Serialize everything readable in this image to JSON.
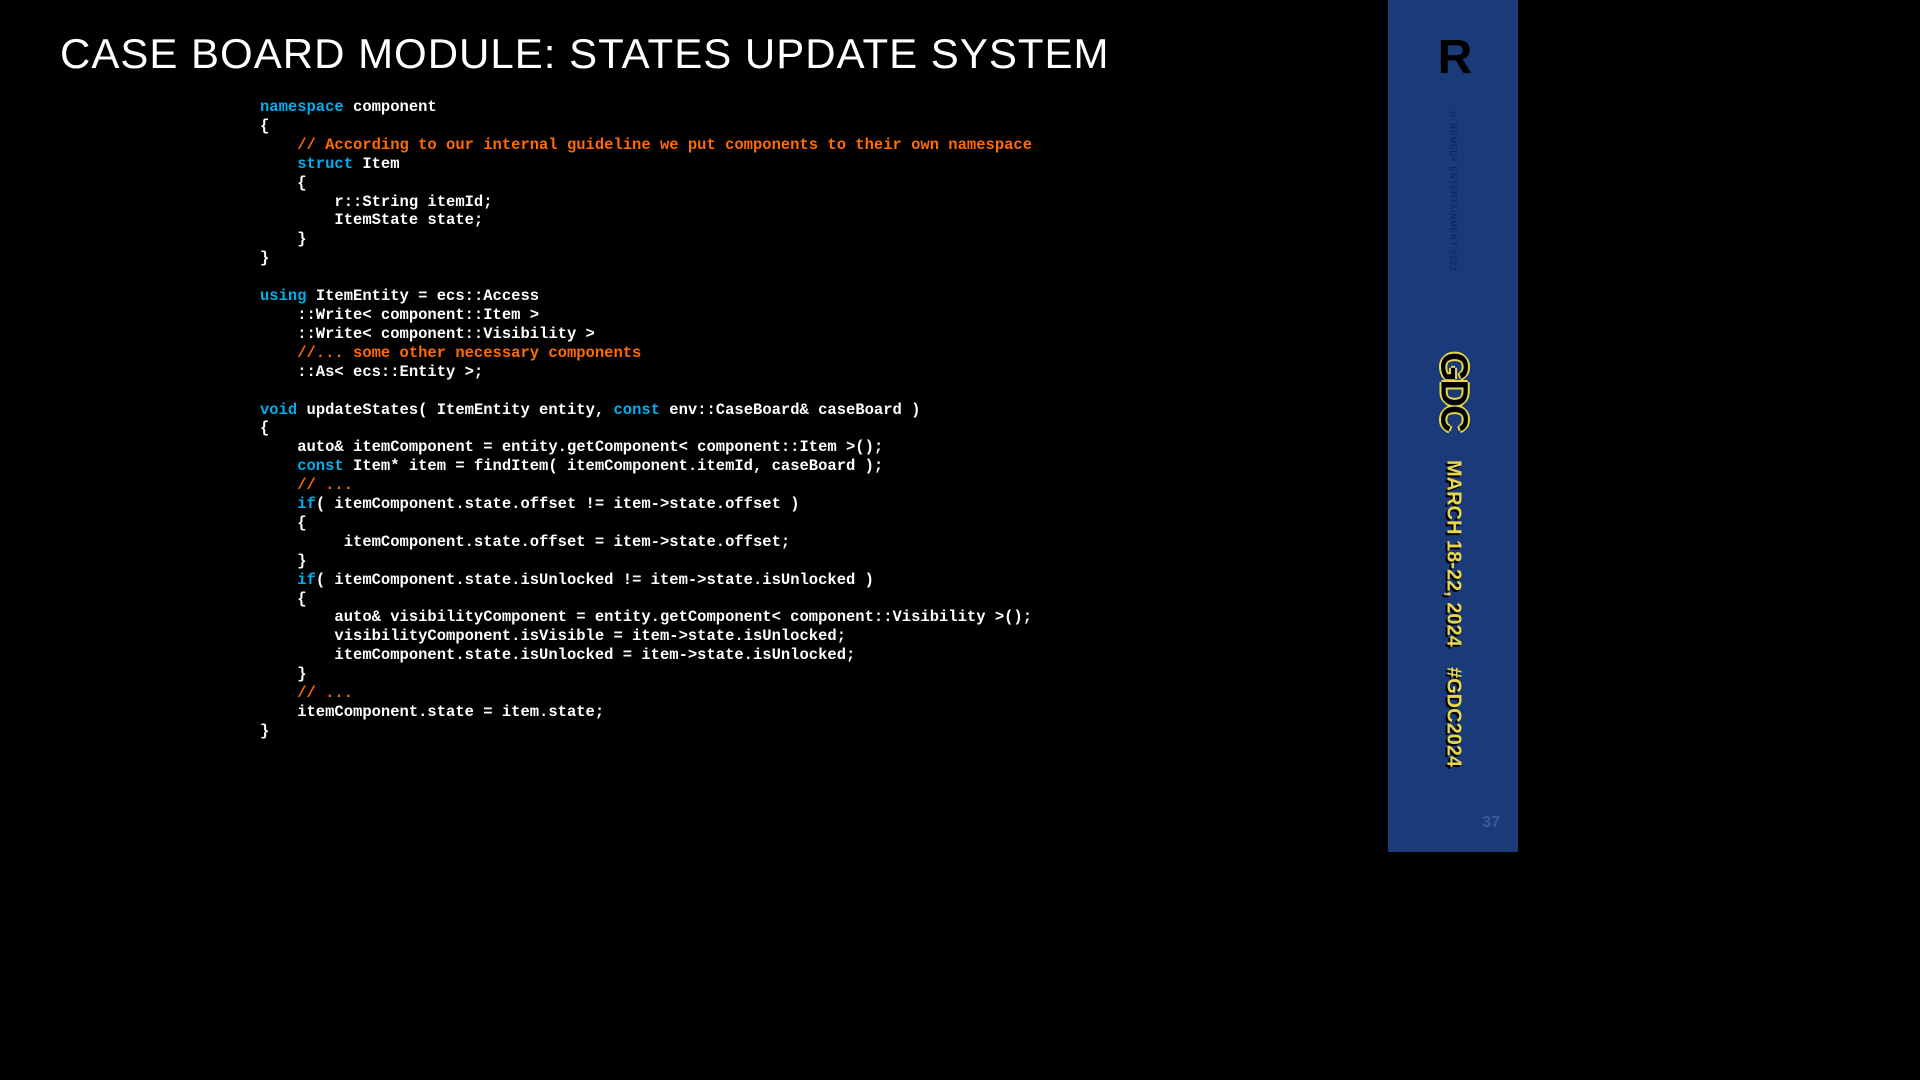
{
  "title": "CASE BOARD MODULE: STATES UPDATE SYSTEM",
  "code": {
    "l1a": "namespace",
    "l1b": " component",
    "l2": "{",
    "l3": "    // According to our internal guideline we put components to their own namespace",
    "l4a": "    struct",
    "l4b": " Item",
    "l5": "    {",
    "l6": "        r::String itemId;",
    "l7": "        ItemState state;",
    "l8": "    }",
    "l9": "}",
    "l10": "",
    "l11a": "using",
    "l11b": " ItemEntity = ecs::Access",
    "l12": "    ::Write< component::Item >",
    "l13": "    ::Write< component::Visibility >",
    "l14": "    //... some other necessary components",
    "l15": "    ::As< ecs::Entity >;",
    "l16": "",
    "l17a": "void",
    "l17b": " updateStates( ItemEntity entity, ",
    "l17c": "const",
    "l17d": " env::CaseBoard& caseBoard )",
    "l18": "{",
    "l19": "    auto& itemComponent = entity.getComponent< component::Item >();",
    "l20a": "    const",
    "l20b": " Item* item = findItem( itemComponent.itemId, caseBoard );",
    "l21": "    // ...",
    "l22a": "    if",
    "l22b": "( itemComponent.state.offset != item->state.offset )",
    "l23": "    {",
    "l24": "         itemComponent.state.offset = item->state.offset;",
    "l25": "    }",
    "l26a": "    if",
    "l26b": "( itemComponent.state.isUnlocked != item->state.isUnlocked )",
    "l27": "    {",
    "l28": "        auto& visibilityComponent = entity.getComponent< component::Visibility >();",
    "l29": "        visibilityComponent.isVisible = item->state.isUnlocked;",
    "l30": "        itemComponent.state.isUnlocked = item->state.isUnlocked;",
    "l31": "    }",
    "l32": "    // ...",
    "l33": "    itemComponent.state = item.state;",
    "l34": "}"
  },
  "sidebar": {
    "logo": "R",
    "copyright": "© REMEDY ENTERTAINMENT 2023",
    "gdc": "GDC",
    "date": "MARCH 18-22, 2024",
    "hashtag": "#GDC2024",
    "page": "37"
  }
}
